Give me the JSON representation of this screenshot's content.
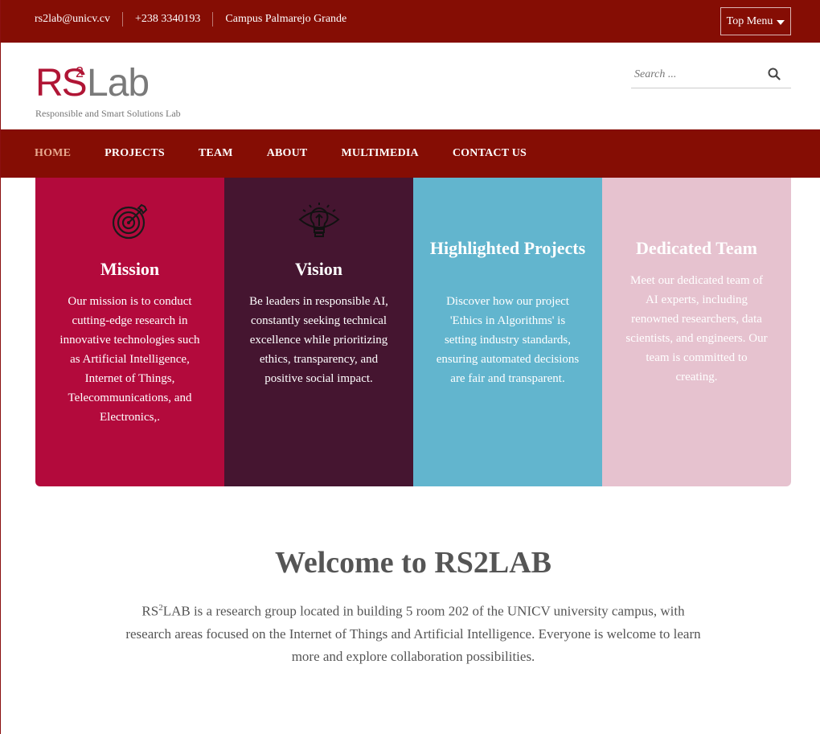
{
  "topbar": {
    "email": "rs2lab@unicv.cv",
    "phone": "+238 3340193",
    "location": "Campus Palmarejo Grande",
    "menu_button": "Top Menu"
  },
  "header": {
    "logo_rs": "RS",
    "logo_sup": "2",
    "logo_lab": "Lab",
    "tagline": "Responsible and Smart Solutions Lab",
    "search_placeholder": "Search ..."
  },
  "nav": {
    "items": [
      "HOME",
      "PROJECTS",
      "TEAM",
      "ABOUT",
      "MULTIMEDIA",
      "CONTACT US"
    ],
    "active": "HOME"
  },
  "cards": [
    {
      "title": "Mission",
      "icon": "target-icon",
      "text": "Our mission is to conduct cutting-edge research in innovative technologies such as Artificial Intelligence, Internet of Things, Telecommunications, and Electronics,.",
      "color": "#b30a3c"
    },
    {
      "title": "Vision",
      "icon": "lightbulb-eye-icon",
      "text": "Be leaders in responsible AI, constantly seeking technical excellence while prioritizing ethics, transparency, and positive social impact.",
      "color": "#451530"
    },
    {
      "title": "Highlighted Projects",
      "text": "Discover how our project 'Ethics in Algorithms' is setting industry standards, ensuring automated decisions are fair and transparent.",
      "color": "#62b5ce"
    },
    {
      "title": "Dedicated Team",
      "text": "Meet our dedicated team of AI experts, including renowned researchers, data scientists, and engineers. Our team is committed to creating.",
      "color": "#e6c2cf"
    }
  ],
  "welcome": {
    "title": "Welcome to RS2LAB",
    "name_prefix": "RS",
    "name_sup": "2",
    "name_suffix": "LAB",
    "text": " is a research group located in building 5 room 202 of the UNICV university campus, with research areas focused on the Internet of Things and Artificial Intelligence. Everyone is welcome to learn more and explore collaboration possibilities."
  },
  "colors": {
    "brand_dark_red": "#850d04",
    "logo_red": "#b01535",
    "active_nav": "#e8a98f"
  }
}
